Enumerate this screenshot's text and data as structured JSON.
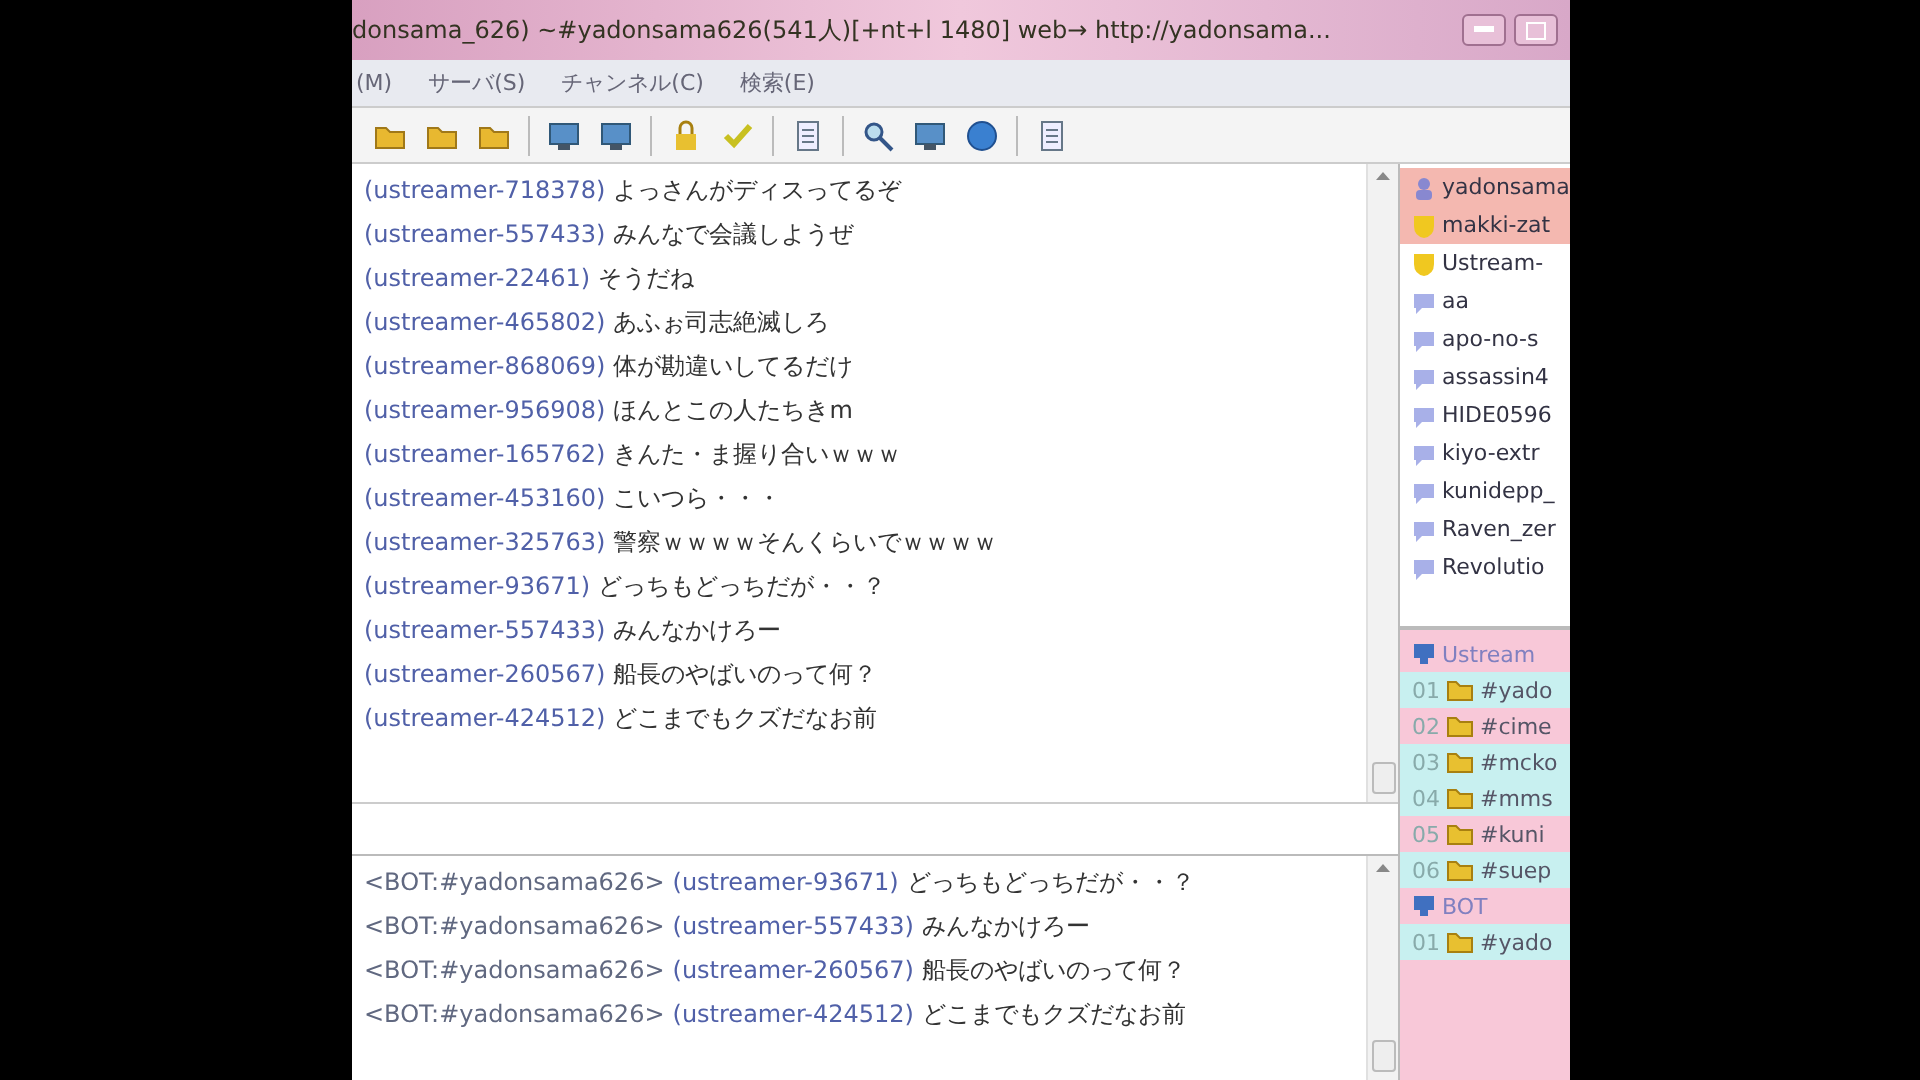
{
  "window": {
    "title": "donsama_626) ~#yadonsama626(541人)[+nt+l 1480] web→ http://yadonsama..."
  },
  "menu": [
    "(M)",
    "サーバ(S)",
    "チャンネル(C)",
    "検索(E)"
  ],
  "chat": [
    {
      "user": "(ustreamer-718378)",
      "text": "よっさんがディスってるぞ"
    },
    {
      "user": "(ustreamer-557433)",
      "text": "みんなで会議しようぜ"
    },
    {
      "user": "(ustreamer-22461)",
      "text": "そうだね"
    },
    {
      "user": "(ustreamer-465802)",
      "text": "あふぉ司志絶滅しろ"
    },
    {
      "user": "(ustreamer-868069)",
      "text": "体が勘違いしてるだけ"
    },
    {
      "user": "(ustreamer-956908)",
      "text": "ほんとこの人たちきm"
    },
    {
      "user": "(ustreamer-165762)",
      "text": "きんた・ま握り合いｗｗｗ"
    },
    {
      "user": "(ustreamer-453160)",
      "text": "こいつら・・・"
    },
    {
      "user": "(ustreamer-325763)",
      "text": "警察ｗｗｗｗそんくらいでｗｗｗｗ"
    },
    {
      "user": "(ustreamer-93671)",
      "text": "どっちもどっちだが・・？"
    },
    {
      "user": "(ustreamer-557433)",
      "text": "みんなかけろー"
    },
    {
      "user": "(ustreamer-260567)",
      "text": "船長のやばいのって何？"
    },
    {
      "user": "(ustreamer-424512)",
      "text": "どこまでもクズだなお前"
    }
  ],
  "log": [
    {
      "source": "<BOT:#yadonsama626>",
      "user": "(ustreamer-93671)",
      "text": "どっちもどっちだが・・？"
    },
    {
      "source": "<BOT:#yadonsama626>",
      "user": "(ustreamer-557433)",
      "text": "みんなかけろー"
    },
    {
      "source": "<BOT:#yadonsama626>",
      "user": "(ustreamer-260567)",
      "text": "船長のやばいのって何？"
    },
    {
      "source": "<BOT:#yadonsama626>",
      "user": "(ustreamer-424512)",
      "text": "どこまでもクズだなお前"
    }
  ],
  "users": [
    {
      "name": "yadonsama",
      "kind": "owner",
      "selected": true
    },
    {
      "name": "makki-zat",
      "kind": "op",
      "selected": true
    },
    {
      "name": "Ustream-",
      "kind": "op",
      "selected": false
    },
    {
      "name": "aa",
      "kind": "normal",
      "selected": false
    },
    {
      "name": "apo-no-s",
      "kind": "normal",
      "selected": false
    },
    {
      "name": "assassin4",
      "kind": "normal",
      "selected": false
    },
    {
      "name": "HIDE0596",
      "kind": "normal",
      "selected": false
    },
    {
      "name": "kiyo-extr",
      "kind": "normal",
      "selected": false
    },
    {
      "name": "kunidepp_",
      "kind": "normal",
      "selected": false
    },
    {
      "name": "Raven_zer",
      "kind": "normal",
      "selected": false
    },
    {
      "name": "Revolutio",
      "kind": "normal",
      "selected": false
    }
  ],
  "channels": [
    {
      "kind": "server",
      "name": "Ustream",
      "color": "#f8c8d8"
    },
    {
      "kind": "channel",
      "number": "01",
      "name": "#yado",
      "color": "#c8f0f0"
    },
    {
      "kind": "channel",
      "number": "02",
      "name": "#cime",
      "color": "#f8c8d8"
    },
    {
      "kind": "channel",
      "number": "03",
      "name": "#mcko",
      "color": "#c8f0f0"
    },
    {
      "kind": "channel",
      "number": "04",
      "name": "#mms",
      "color": "#c8f0f0"
    },
    {
      "kind": "channel",
      "number": "05",
      "name": "#kuni",
      "color": "#f8c8d8"
    },
    {
      "kind": "channel",
      "number": "06",
      "name": "#suep",
      "color": "#c8f0f0"
    },
    {
      "kind": "server",
      "name": "BOT",
      "color": "#f8c8d8"
    },
    {
      "kind": "channel",
      "number": "01",
      "name": "#yado",
      "color": "#c8f0f0"
    }
  ]
}
